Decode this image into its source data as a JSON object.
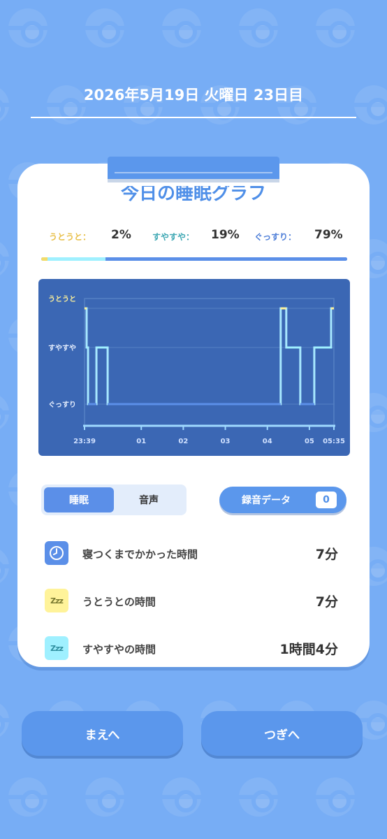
{
  "header": {
    "date": "2026年5月19日 火曜日 23日目"
  },
  "card": {
    "title": "今日の睡眠グラフ"
  },
  "stats": [
    {
      "label": "うとうと：",
      "value": "2%",
      "color": "#e8c04a"
    },
    {
      "label": "すやすや：",
      "value": "19%",
      "color": "#3fa8b4"
    },
    {
      "label": "ぐっすり：",
      "value": "79%",
      "color": "#4f7fd8"
    }
  ],
  "ratio": {
    "utouto": 2,
    "suyasuya": 19,
    "gussuri": 79
  },
  "chart_data": {
    "type": "line",
    "y_categories": [
      "うとうと",
      "すやすや",
      "ぐっすり"
    ],
    "x_ticks": [
      "23:39",
      "01",
      "02",
      "03",
      "04",
      "05",
      "05:35"
    ],
    "x_range": [
      "23:39",
      "05:35"
    ],
    "series": [
      {
        "points": [
          [
            "23:39",
            "うとうと"
          ],
          [
            "23:42",
            "すやすや"
          ],
          [
            "23:44",
            "ぐっすり"
          ],
          [
            "23:56",
            "すやすや"
          ],
          [
            "00:12",
            "ぐっすり"
          ],
          [
            "04:17",
            "ぐっすり"
          ],
          [
            "04:19",
            "うとうと"
          ],
          [
            "04:27",
            "すやすや"
          ],
          [
            "04:47",
            "ぐっすり"
          ],
          [
            "05:07",
            "すやすや"
          ],
          [
            "05:29",
            "すやすや"
          ],
          [
            "05:31",
            "うとうと"
          ],
          [
            "05:35",
            "うとうと"
          ]
        ]
      }
    ],
    "colors": {
      "うとうと": "#fff39a",
      "すやすや": "#9ff0ff",
      "ぐっすり": "#5b8fe8"
    },
    "grid": true
  },
  "tabs": {
    "sleep": "睡眠",
    "voice": "音声"
  },
  "record": {
    "label": "録音データ",
    "count": "0"
  },
  "info": [
    {
      "label": "寝つくまでかかった時間",
      "value": "7分",
      "icon": "clock-icon"
    },
    {
      "label": "うとうとの時間",
      "value": "7分",
      "icon": "zzz-icon"
    },
    {
      "label": "すやすやの時間",
      "value": "1時間4分",
      "icon": "zzz-icon"
    }
  ],
  "zzz_text": "Zzz",
  "nav": {
    "prev": "まえへ",
    "next": "つぎへ"
  }
}
